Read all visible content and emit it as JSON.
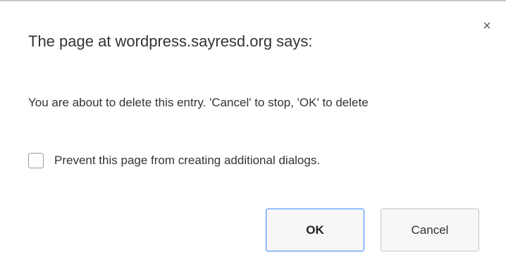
{
  "dialog": {
    "title": "The page at wordpress.sayresd.org says:",
    "close_icon": "close-icon",
    "close_glyph": "×",
    "message": "You are about to delete this entry. 'Cancel' to stop, 'OK' to delete",
    "checkbox_label": "Prevent this page from creating additional dialogs.",
    "checkbox_checked": false,
    "ok_label": "OK",
    "cancel_label": "Cancel"
  },
  "colors": {
    "focus_border": "#4d90fe",
    "button_bg": "#f7f7f7",
    "text": "#333333"
  }
}
